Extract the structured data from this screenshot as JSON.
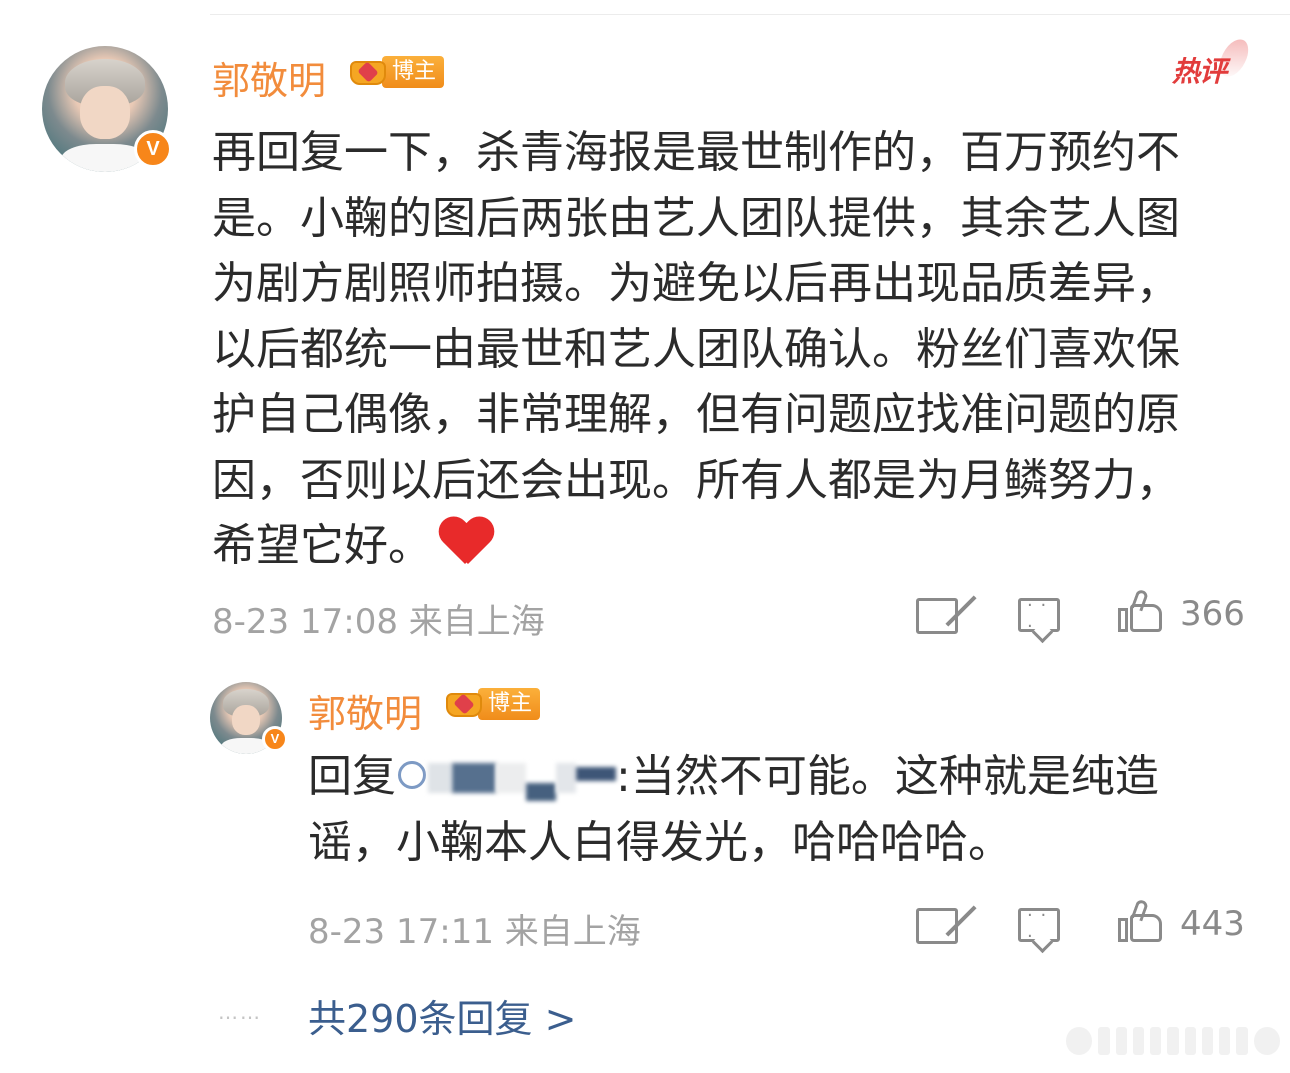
{
  "comment": {
    "username": "郭敬明",
    "badge_label": "博主",
    "hot_label": "热评",
    "verified_mark": "V",
    "text_lines": [
      "再回复一下，杀青海报是最世制作的，百万预约不",
      "是。小鞠的图后两张由艺人团队提供，其余艺人图",
      "为剧方剧照师拍摄。为避免以后再出现品质差异，",
      "以后都统一由最世和艺人团队确认。粉丝们喜欢保",
      "护自己偶像，非常理解，但有问题应找准问题的原",
      "因，否则以后还会出现。所有人都是为月鳞努力，",
      "希望它好。"
    ],
    "emoji": "heart-icon",
    "time": "8-23 17:08",
    "location": "来自上海",
    "like_count": "366"
  },
  "reply": {
    "username": "郭敬明",
    "badge_label": "博主",
    "verified_mark": "V",
    "prefix": "回复",
    "text_line1_suffix": ":当然不可能。这种就是纯造",
    "text_line2": "谣，小鞠本人白得发光，哈哈哈哈。",
    "time": "8-23 17:11",
    "location": "来自上海",
    "like_count": "443"
  },
  "more_replies": {
    "dots": "……",
    "label": "共290条回复 >"
  },
  "colors": {
    "username": "#f28c3c",
    "hot": "#e23c3c",
    "link": "#3b5e8e",
    "meta": "#a3a3a3"
  }
}
